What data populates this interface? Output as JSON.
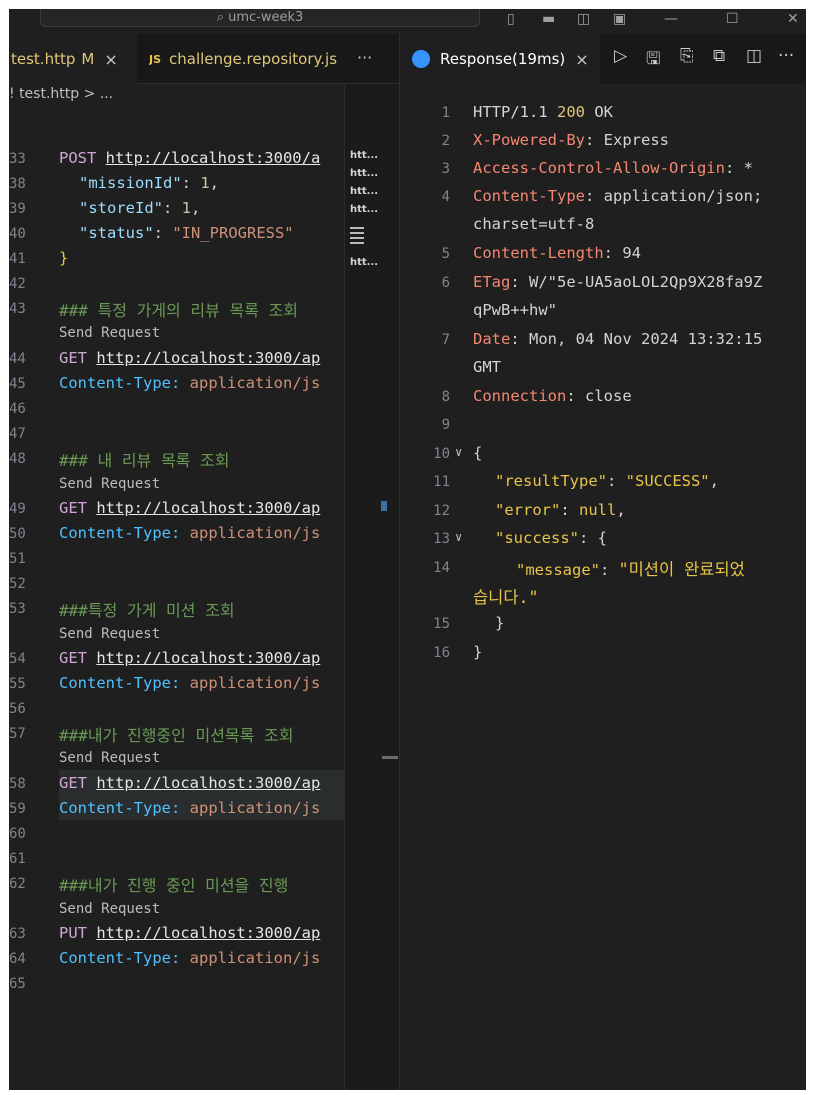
{
  "titlebar": {
    "search_text": "umc-week3"
  },
  "left_tabs": [
    {
      "label": "test.http",
      "badge": "M",
      "close": "×"
    },
    {
      "label": "challenge.repository.js",
      "type": "JS"
    }
  ],
  "left_more": "···",
  "breadcrumb": {
    "file": "test.http",
    "rest": "> ..."
  },
  "editor": {
    "codelens": "Send Request",
    "lines": {
      "l33": {
        "num": "33",
        "kw": "POST",
        "url": "http://localhost:3000/a"
      },
      "l38": {
        "num": "38",
        "key": "\"missionId\"",
        "rest": ": ",
        "val": "1",
        "tail": ","
      },
      "l39": {
        "num": "39",
        "key": "\"storeId\"",
        "rest": ": ",
        "val": "1",
        "tail": ","
      },
      "l40": {
        "num": "40",
        "key": "\"status\"",
        "rest": ": ",
        "val": "\"IN_PROGRESS\""
      },
      "l41": {
        "num": "41",
        "brace": "}"
      },
      "l42": {
        "num": "42"
      },
      "l43": {
        "num": "43",
        "comment": "### 특정 가게의 리뷰 목록 조회"
      },
      "l44": {
        "num": "44",
        "kw": "GET",
        "url": "http://localhost:3000/ap"
      },
      "l45": {
        "num": "45",
        "header": "Content-Type:",
        "value": "application/js"
      },
      "l46": {
        "num": "46"
      },
      "l47": {
        "num": "47"
      },
      "l48": {
        "num": "48",
        "comment": "### 내 리뷰 목록 조회"
      },
      "l49": {
        "num": "49",
        "kw": "GET",
        "url": "http://localhost:3000/ap"
      },
      "l50": {
        "num": "50",
        "header": "Content-Type:",
        "value": "application/js"
      },
      "l51": {
        "num": "51"
      },
      "l52": {
        "num": "52"
      },
      "l53": {
        "num": "53",
        "comment": "###특정 가게 미션 조회"
      },
      "l54": {
        "num": "54",
        "kw": "GET",
        "url": "http://localhost:3000/ap"
      },
      "l55": {
        "num": "55",
        "header": "Content-Type:",
        "value": "application/js"
      },
      "l56": {
        "num": "56"
      },
      "l57": {
        "num": "57",
        "comment": "###내가 진행중인 미션목록 조회"
      },
      "l58": {
        "num": "58",
        "kw": "GET",
        "url": "http://localhost:3000/ap"
      },
      "l59": {
        "num": "59",
        "header": "Content-Type:",
        "value": "application/js"
      },
      "l60": {
        "num": "60"
      },
      "l61": {
        "num": "61"
      },
      "l62": {
        "num": "62",
        "comment": "###내가 진행 중인 미션을 진행"
      },
      "l63": {
        "num": "63",
        "kw": "PUT",
        "url": "http://localhost:3000/ap"
      },
      "l64": {
        "num": "64",
        "header": "Content-Type:",
        "value": "application/js"
      },
      "l65": {
        "num": "65"
      }
    }
  },
  "minimap": {
    "items": [
      "htt...",
      "htt...",
      "htt...",
      "htt..."
    ],
    "last": "htt..."
  },
  "response_tab": {
    "label": "Response(19ms)",
    "close": "×",
    "more": "···"
  },
  "response": {
    "l1": {
      "num": "1",
      "proto": "HTTP/1.1",
      "code": "200",
      "text": "OK"
    },
    "l2": {
      "num": "2",
      "name": "X-Powered-By",
      "value": "Express"
    },
    "l3": {
      "num": "3",
      "name": "Access-Control-Allow-Origin",
      "value": "*"
    },
    "l4": {
      "num": "4",
      "name": "Content-Type",
      "value": "application/json;",
      "cont": "charset=utf-8"
    },
    "l5": {
      "num": "5",
      "name": "Content-Length",
      "value": "94"
    },
    "l6": {
      "num": "6",
      "name": "ETag",
      "value": "W/\"5e-UA5aoLOL2Qp9X28fa9Z",
      "cont": "qPwB++hw\""
    },
    "l7": {
      "num": "7",
      "name": "Date",
      "value": "Mon, 04 Nov 2024 13:32:15",
      "cont": "GMT"
    },
    "l8": {
      "num": "8",
      "name": "Connection",
      "value": "close"
    },
    "l9": {
      "num": "9"
    },
    "l10": {
      "num": "10",
      "text": "{"
    },
    "l11": {
      "num": "11",
      "key": "\"resultType\"",
      "val": "\"SUCCESS\""
    },
    "l12": {
      "num": "12",
      "key": "\"error\"",
      "val": "null"
    },
    "l13": {
      "num": "13",
      "key": "\"success\"",
      "val": "{"
    },
    "l14": {
      "num": "14",
      "key": "\"message\"",
      "val": "\"미션이 완료되었",
      "cont": "습니다.\""
    },
    "l15": {
      "num": "15",
      "text": "}"
    },
    "l16": {
      "num": "16",
      "text": "}"
    }
  }
}
